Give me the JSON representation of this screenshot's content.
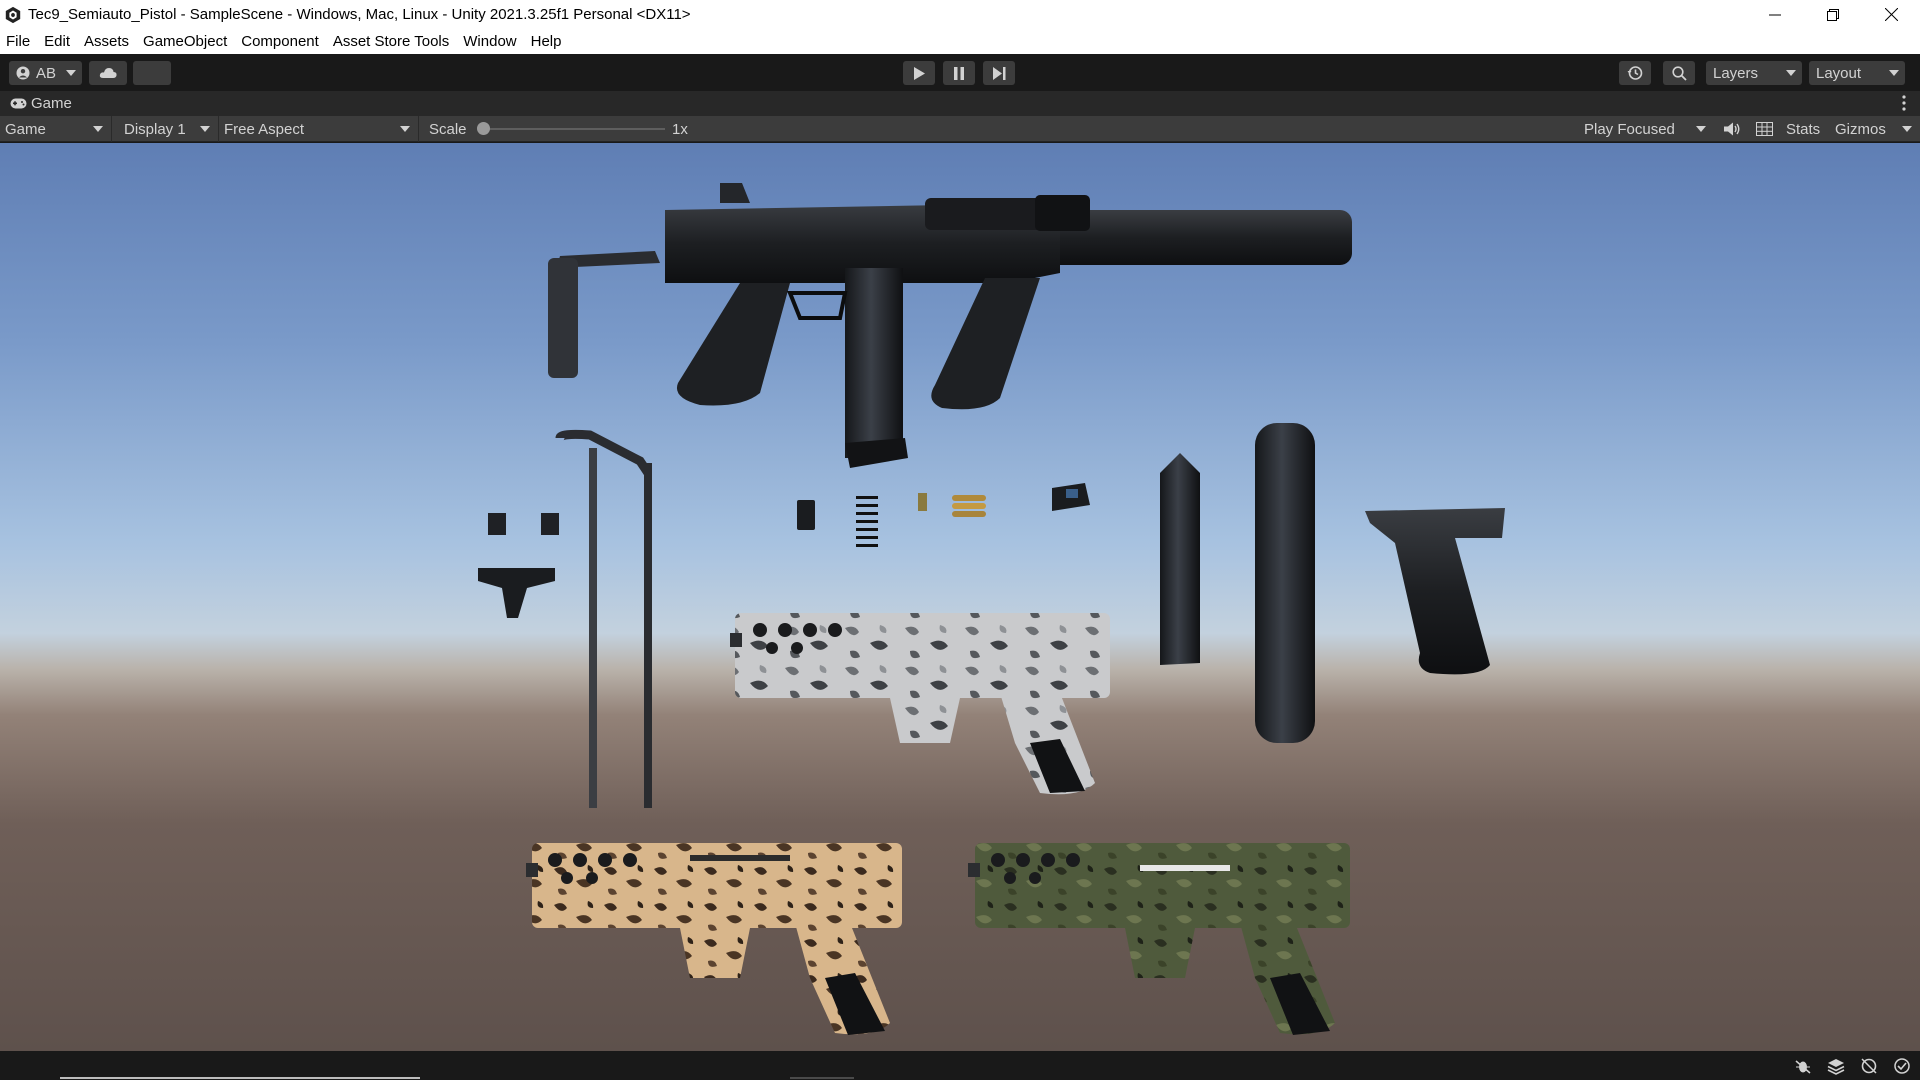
{
  "window": {
    "title": "Tec9_Semiauto_Pistol - SampleScene - Windows, Mac, Linux - Unity 2021.3.25f1 Personal <DX11>"
  },
  "menu": [
    "File",
    "Edit",
    "Assets",
    "GameObject",
    "Component",
    "Asset Store Tools",
    "Window",
    "Help"
  ],
  "toolbar": {
    "account_label": "AB",
    "layers_label": "Layers",
    "layout_label": "Layout"
  },
  "game_tab": {
    "label": "Game"
  },
  "game_bar": {
    "view_label": "Game",
    "display_label": "Display 1",
    "aspect_label": "Free Aspect",
    "scale_label": "Scale",
    "scale_value_label": "1x",
    "scale_value": 1,
    "play_mode_label": "Play Focused",
    "stats_label": "Stats",
    "gizmos_label": "Gizmos"
  },
  "colors": {
    "editor_dark": "#191919",
    "panel": "#3c3c3c",
    "text_light": "#d2d2d2",
    "sky_top": "#5f7eb4",
    "horizon": "#c3d1de",
    "ground": "#5e514c"
  },
  "icons": {
    "app": "unity-logo-icon",
    "account": "account-icon",
    "cloud": "cloud-icon",
    "play": "play-icon",
    "pause": "pause-icon",
    "step": "step-icon",
    "history": "history-icon",
    "search": "search-icon",
    "mute": "speaker-icon",
    "grid": "grid-icon"
  }
}
